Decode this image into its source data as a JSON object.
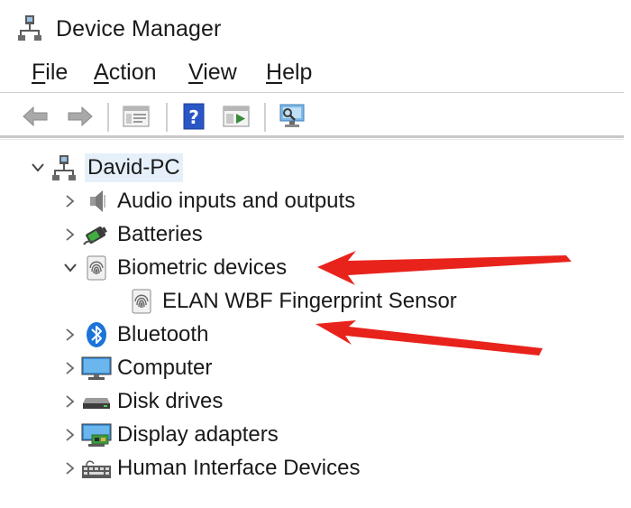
{
  "window": {
    "title": "Device Manager"
  },
  "menu": [
    {
      "accel": "F",
      "rest": "ile"
    },
    {
      "accel": "A",
      "rest": "ction"
    },
    {
      "accel": "V",
      "rest": "iew"
    },
    {
      "accel": "H",
      "rest": "elp"
    }
  ],
  "toolbar": {
    "buttons": [
      "back-icon",
      "forward-icon",
      "properties-icon",
      "help-icon",
      "update-driver-icon",
      "scan-hardware-icon"
    ]
  },
  "tree": {
    "root": {
      "label": "David-PC",
      "expanded": true,
      "icon": "computer-network-icon"
    },
    "categories": [
      {
        "label": "Audio inputs and outputs",
        "icon": "speaker-icon",
        "expanded": false
      },
      {
        "label": "Batteries",
        "icon": "battery-icon",
        "expanded": false
      },
      {
        "label": "Biometric devices",
        "icon": "fingerprint-icon",
        "expanded": true,
        "children": [
          {
            "label": "ELAN WBF Fingerprint Sensor",
            "icon": "fingerprint-icon"
          }
        ]
      },
      {
        "label": "Bluetooth",
        "icon": "bluetooth-icon",
        "expanded": false
      },
      {
        "label": "Computer",
        "icon": "monitor-icon",
        "expanded": false
      },
      {
        "label": "Disk drives",
        "icon": "disk-drive-icon",
        "expanded": false
      },
      {
        "label": "Display adapters",
        "icon": "display-adapter-icon",
        "expanded": false
      },
      {
        "label": "Human Interface Devices",
        "icon": "keyboard-icon",
        "expanded": false
      }
    ]
  },
  "annotation": {
    "arrow_color": "#e8231c",
    "arrow_count": 2
  },
  "colors": {
    "selection": "#e5f0fb",
    "bluetooth": "#1b74d8",
    "help": "#2a56c6"
  }
}
